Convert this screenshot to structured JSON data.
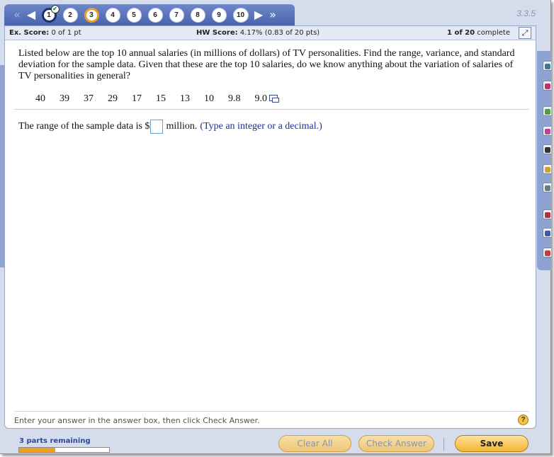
{
  "nav": {
    "questions": [
      "1",
      "2",
      "3",
      "4",
      "5",
      "6",
      "7",
      "8",
      "9",
      "10"
    ],
    "section": "3.3.5"
  },
  "score": {
    "ex_label": "Ex. Score:",
    "ex_value": "0 of 1 pt",
    "hw_label": "HW Score:",
    "hw_value": "4.17% (0.83 of 20 pts)",
    "progress_bold": "1 of 20",
    "progress_text": "complete"
  },
  "question": {
    "text": "Listed below are the top 10 annual salaries (in millions of dollars) of TV personalities. Find the range, variance, and standard deviation for the sample data. Given that these are the top 10 salaries, do we know anything about the variation of salaries of TV personalities in general?",
    "data": [
      "40",
      "39",
      "37",
      "29",
      "17",
      "15",
      "13",
      "10",
      "9.8",
      "9.0"
    ]
  },
  "answer": {
    "prefix": "The range of the sample data is $",
    "suffix": "million.",
    "hint": "(Type an integer or a decimal.)",
    "value": ""
  },
  "footer": {
    "instructions": "Enter your answer in the answer box, then click Check Answer.",
    "help": "?"
  },
  "bottom": {
    "parts_remaining": "3 parts remaining",
    "parts_progress": 0.4,
    "clear_all": "Clear All",
    "check_answer": "Check Answer",
    "save": "Save"
  },
  "colors": {
    "nav_bar": "#4a64b0",
    "accent_orange": "#f0a020",
    "hint_blue": "#1a2a9a"
  }
}
